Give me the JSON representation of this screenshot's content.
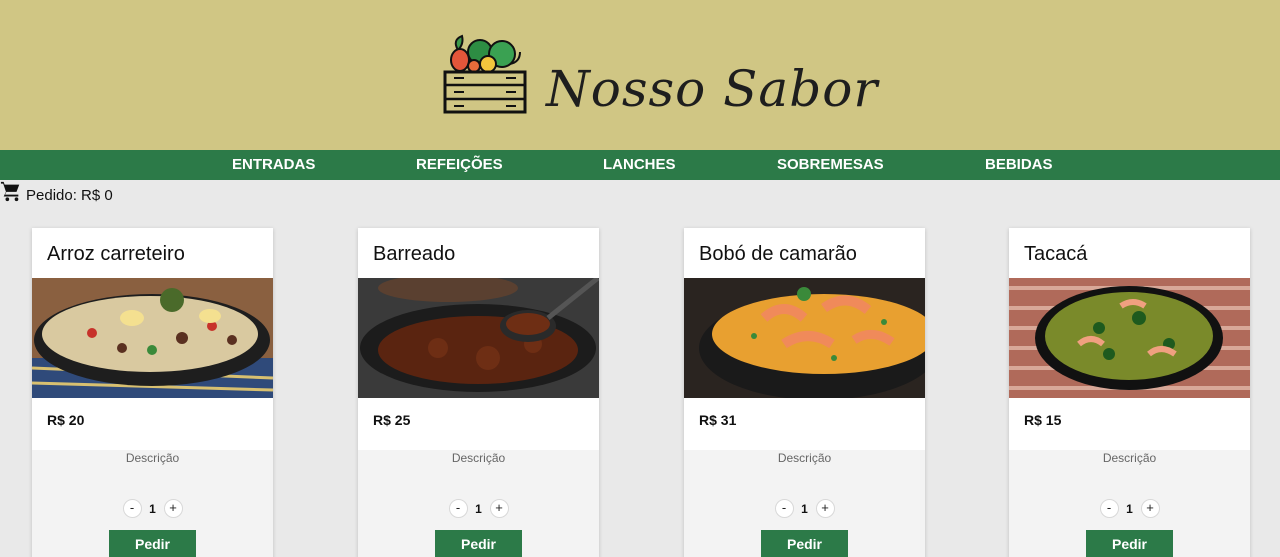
{
  "header": {
    "brand": "Nosso Sabor",
    "logo_icon": "vegetable-crate-icon"
  },
  "nav": {
    "items": [
      "ENTRADAS",
      "REFEIÇÕES",
      "LANCHES",
      "SOBREMESAS",
      "BEBIDAS"
    ]
  },
  "order": {
    "icon": "cart-icon",
    "label": "Pedido: R$ 0"
  },
  "products": [
    {
      "name": "Arroz carreteiro",
      "price": "R$ 20",
      "description": "Descrição",
      "qty": "1",
      "qty_minus": "-",
      "qty_plus": "+",
      "button": "Pedir"
    },
    {
      "name": "Barreado",
      "price": "R$ 25",
      "description": "Descrição",
      "qty": "1",
      "qty_minus": "-",
      "qty_plus": "+",
      "button": "Pedir"
    },
    {
      "name": "Bobó de camarão",
      "price": "R$ 31",
      "description": "Descrição",
      "qty": "1",
      "qty_minus": "-",
      "qty_plus": "+",
      "button": "Pedir"
    },
    {
      "name": "Tacacá",
      "price": "R$ 15",
      "description": "Descrição",
      "qty": "1",
      "qty_minus": "-",
      "qty_plus": "+",
      "button": "Pedir"
    }
  ],
  "colors": {
    "header_bg": "#d0c684",
    "nav_bg": "#2c7a48",
    "page_bg": "#e9e9e9",
    "button_bg": "#2c7a48"
  }
}
